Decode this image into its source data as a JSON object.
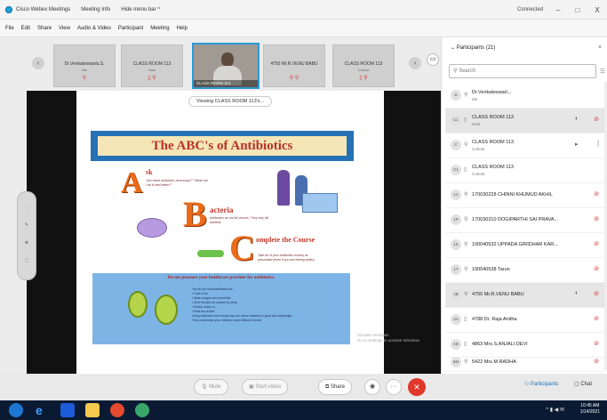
{
  "titlebar": {
    "app": "Cisco Webex Meetings",
    "meeting_info": "Meeting Info",
    "hide_menu": "Hide menu bar ^",
    "status": "Connected",
    "status_icon": "connection-indicator-icon",
    "minimize": "–",
    "restore": "□",
    "close": "X"
  },
  "menu": [
    "File",
    "Edit",
    "Share",
    "View",
    "Audio & Video",
    "Participant",
    "Meeting",
    "Help"
  ],
  "strip": {
    "prev": "‹",
    "next": "›",
    "expand": "▭",
    "tiles": [
      {
        "name": "Dr.Venkateswarlu.S.",
        "role": "Me",
        "icons": "⚲"
      },
      {
        "name": "CLASS ROOM 113",
        "role": "Host",
        "icons": "▯ ⚲"
      },
      {
        "name": "CLASS ROOM 113",
        "role": "",
        "icons": ""
      },
      {
        "name": "4750 Mr.R.VENU BABU",
        "role": "",
        "icons": "⚲ ⚲"
      },
      {
        "name": "CLASS ROOM 113",
        "role": "Cohost",
        "icons": "▯ ⚲"
      }
    ]
  },
  "share": {
    "viewing": "Viewing CLASS ROOM 113's...",
    "watermark": "Activate Windows\nGo to Settings to activate Windows."
  },
  "slide": {
    "title": "The ABC's of Antibiotics",
    "a_letter": "A",
    "a_word": "sk",
    "a_note": "\"Are these antibiotics necessary?\" \"What can I do to feel better?\"",
    "b_letter": "B",
    "b_word": "acteria",
    "b_note": "Antibiotics do not kill viruses. They only kill bacteria.",
    "c_letter": "C",
    "c_word": "omplete the Course",
    "c_note": "Take all of your antibiotics exactly as prescribed (even if you are feeling better).",
    "bottom_title": "Do not pressure your healthcare provider for antibiotics.",
    "bottom_lines": [
      "You do not need antibiotics for:",
      "• Cold or flu",
      "• Most coughs and bronchitis",
      "• Sore throats not caused by strep",
      "• Runny noses or",
      "• Most ear aches",
      "Using antibiotics the wrong way can cause bacteria to grow into superbugs.",
      "This could make your infection more difficult to treat."
    ]
  },
  "controls": {
    "mute": "Mute",
    "start_video": "Start video",
    "share": "Share",
    "more": "···",
    "end": "✕",
    "participants": "Participants",
    "chat": "Chat"
  },
  "panel": {
    "title": "Participants (21)",
    "search_placeholder": "Search",
    "participants": [
      {
        "initials": "D",
        "name": "Dr.Venkateswarl...",
        "role": "Me",
        "status": "",
        "mic_on": false
      },
      {
        "initials": "C1",
        "name": "CLASS ROOM 113",
        "role": "Host",
        "status": "◐",
        "mic_on": false
      },
      {
        "initials": "C",
        "name": "CLASS ROOM 113",
        "role": "Cohost",
        "status": "▸",
        "mic_on": true
      },
      {
        "initials": "C1",
        "name": "CLASS ROOM 113",
        "role": "Cohost",
        "status": "",
        "mic_on": false
      },
      {
        "initials": "1A",
        "name": "170030228 CHINNI KHUMUD AKHIL",
        "role": "",
        "status": "",
        "mic_on": false
      },
      {
        "initials": "1P",
        "name": "170030310 DOGIPARTHI SAI PRAVA...",
        "role": "",
        "status": "",
        "mic_on": false
      },
      {
        "initials": "1K",
        "name": "190040532 UPPADA GIRIDHAR KAR...",
        "role": "",
        "status": "",
        "mic_on": false
      },
      {
        "initials": "1T",
        "name": "190040538 Tarun",
        "role": "",
        "status": "",
        "mic_on": false
      },
      {
        "initials": "4B",
        "name": "4750 Mr.R.VENU BABU",
        "role": "",
        "status": "◐",
        "mic_on": false
      },
      {
        "initials": "4A",
        "name": "4788 Dr. Raja Anitha",
        "role": "",
        "status": "",
        "mic_on": false
      },
      {
        "initials": "4D",
        "name": "4863 Mrs.S.ANJALI DEVI",
        "role": "",
        "status": "",
        "mic_on": false
      },
      {
        "initials": "5M",
        "name": "5422 Mrs.M.RADHA",
        "role": "",
        "status": "",
        "mic_on": false
      }
    ]
  },
  "taskbar": {
    "time": "10:45 AM",
    "date": "1/14/2021"
  },
  "colors": {
    "accent": "#1a6fb5",
    "end_call": "#e0382b",
    "slide_banner": "#2672b6",
    "slide_title_text": "#b8322a",
    "mic_muted": "#d33333",
    "mic_on": "#2c9b3f"
  }
}
